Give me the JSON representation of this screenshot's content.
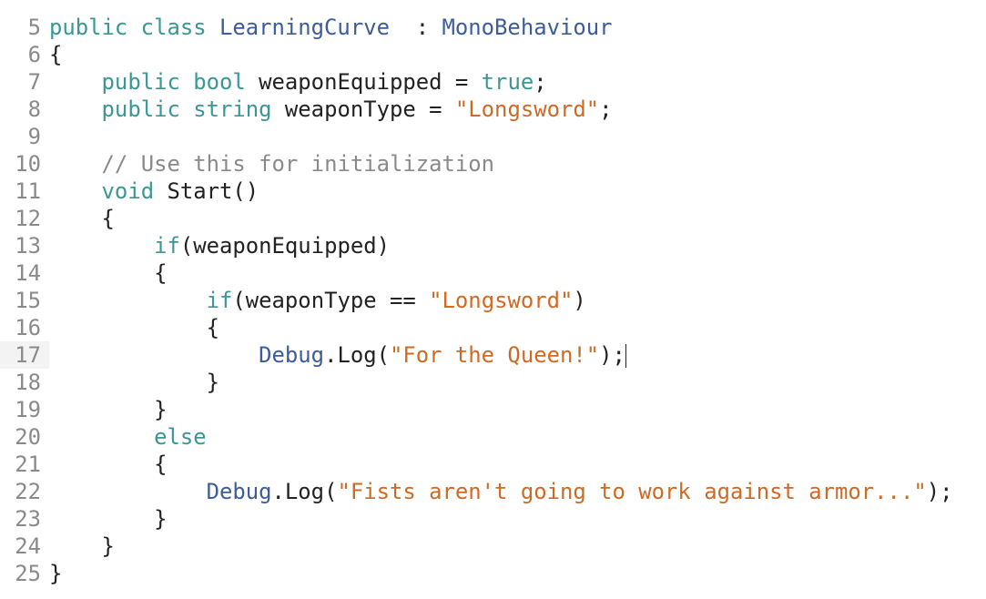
{
  "editor": {
    "current_line": 17,
    "lines": [
      {
        "n": "5",
        "t": [
          [
            "kw",
            "public class "
          ],
          [
            "ty",
            "LearningCurve"
          ],
          [
            "",
            "  : "
          ],
          [
            "ty",
            "MonoBehaviour"
          ]
        ]
      },
      {
        "n": "6",
        "t": [
          [
            "",
            "{"
          ]
        ]
      },
      {
        "n": "7",
        "t": [
          [
            "",
            "    "
          ],
          [
            "kw",
            "public bool"
          ],
          [
            "",
            " weaponEquipped = "
          ],
          [
            "kw",
            "true"
          ],
          [
            "",
            ";"
          ]
        ]
      },
      {
        "n": "8",
        "t": [
          [
            "",
            "    "
          ],
          [
            "kw",
            "public string"
          ],
          [
            "",
            " weaponType = "
          ],
          [
            "str",
            "\"Longsword\""
          ],
          [
            "",
            ";"
          ]
        ]
      },
      {
        "n": "9",
        "t": []
      },
      {
        "n": "10",
        "t": [
          [
            "",
            "    "
          ],
          [
            "cm",
            "// Use this for initialization"
          ]
        ]
      },
      {
        "n": "11",
        "t": [
          [
            "",
            "    "
          ],
          [
            "kw",
            "void"
          ],
          [
            "",
            " Start()"
          ]
        ]
      },
      {
        "n": "12",
        "t": [
          [
            "",
            "    {"
          ]
        ]
      },
      {
        "n": "13",
        "t": [
          [
            "",
            "        "
          ],
          [
            "kw",
            "if"
          ],
          [
            "",
            "(weaponEquipped)"
          ]
        ]
      },
      {
        "n": "14",
        "t": [
          [
            "",
            "        {"
          ]
        ]
      },
      {
        "n": "15",
        "t": [
          [
            "",
            "            "
          ],
          [
            "kw",
            "if"
          ],
          [
            "",
            "(weaponType == "
          ],
          [
            "str",
            "\"Longsword\""
          ],
          [
            "",
            ")"
          ]
        ]
      },
      {
        "n": "16",
        "t": [
          [
            "",
            "            {"
          ]
        ]
      },
      {
        "n": "17",
        "t": [
          [
            "",
            "                "
          ],
          [
            "ty",
            "Debug"
          ],
          [
            "",
            ".Log("
          ],
          [
            "str",
            "\"For the Queen!\""
          ],
          [
            "",
            ");"
          ]
        ]
      },
      {
        "n": "18",
        "t": [
          [
            "",
            "            }"
          ]
        ]
      },
      {
        "n": "19",
        "t": [
          [
            "",
            "        }"
          ]
        ]
      },
      {
        "n": "20",
        "t": [
          [
            "",
            "        "
          ],
          [
            "kw",
            "else"
          ]
        ]
      },
      {
        "n": "21",
        "t": [
          [
            "",
            "        {"
          ]
        ]
      },
      {
        "n": "22",
        "t": [
          [
            "",
            "            "
          ],
          [
            "ty",
            "Debug"
          ],
          [
            "",
            ".Log("
          ],
          [
            "str",
            "\"Fists aren't going to work against armor...\""
          ],
          [
            "",
            ");"
          ]
        ]
      },
      {
        "n": "23",
        "t": [
          [
            "",
            "        }"
          ]
        ]
      },
      {
        "n": "24",
        "t": [
          [
            "",
            "    }"
          ]
        ]
      },
      {
        "n": "25",
        "t": [
          [
            "",
            "}"
          ]
        ]
      }
    ]
  }
}
